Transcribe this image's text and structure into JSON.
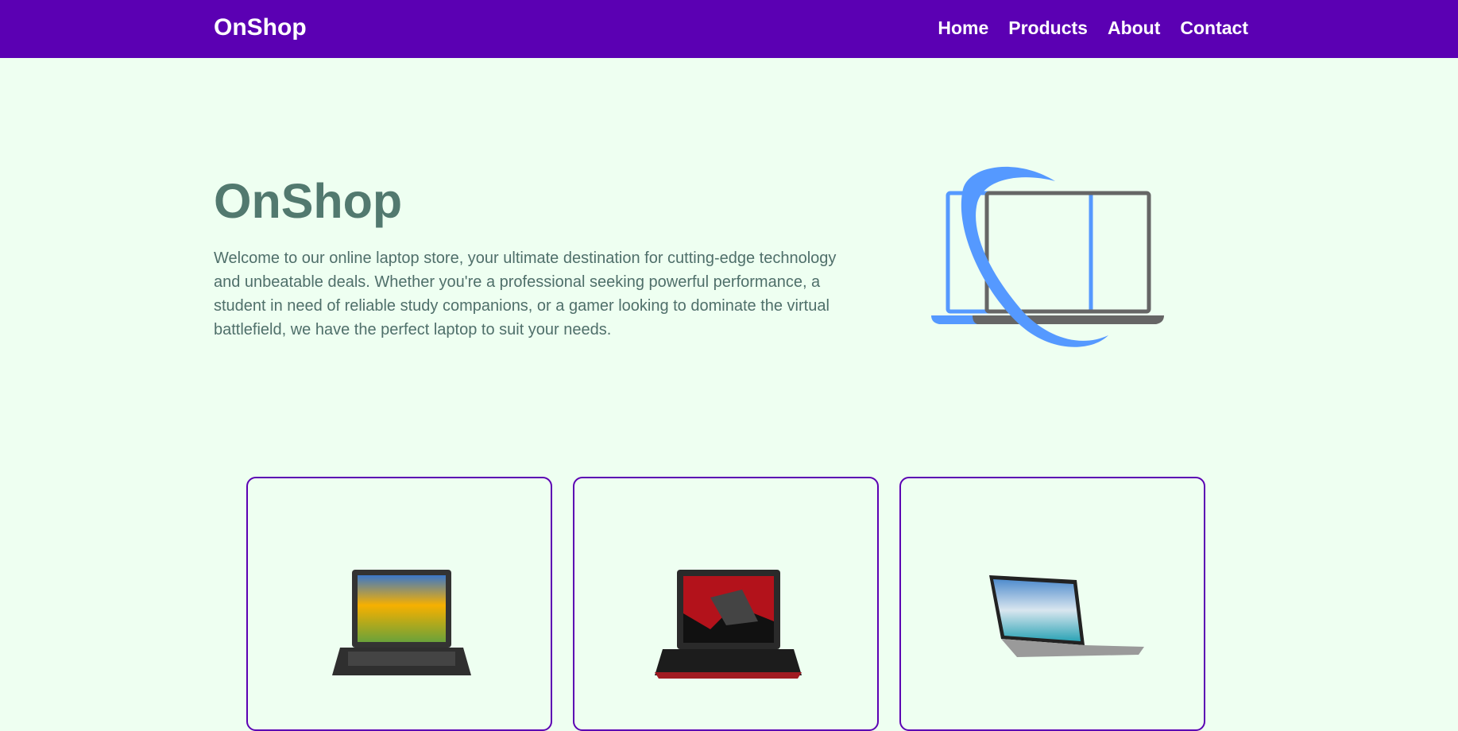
{
  "nav": {
    "brand": "OnShop",
    "links": [
      "Home",
      "Products",
      "About",
      "Contact"
    ]
  },
  "hero": {
    "title": "OnShop",
    "text": "Welcome to our online laptop store, your ultimate destination for cutting-edge technology and unbeatable deals. Whether you're a professional seeking powerful performance, a student in need of reliable study companions, or a gamer looking to dominate the virtual battlefield, we have the perfect laptop to suit your needs."
  },
  "colors": {
    "navbar": "#5b00b3",
    "background": "#eefff1",
    "heading": "#52796f",
    "accent_blue": "#5599ff",
    "laptop_gray": "#666666"
  },
  "products": [
    {
      "image": "acer-laptop-image"
    },
    {
      "image": "predator-gaming-laptop-image"
    },
    {
      "image": "dell-ultrabook-image"
    }
  ]
}
